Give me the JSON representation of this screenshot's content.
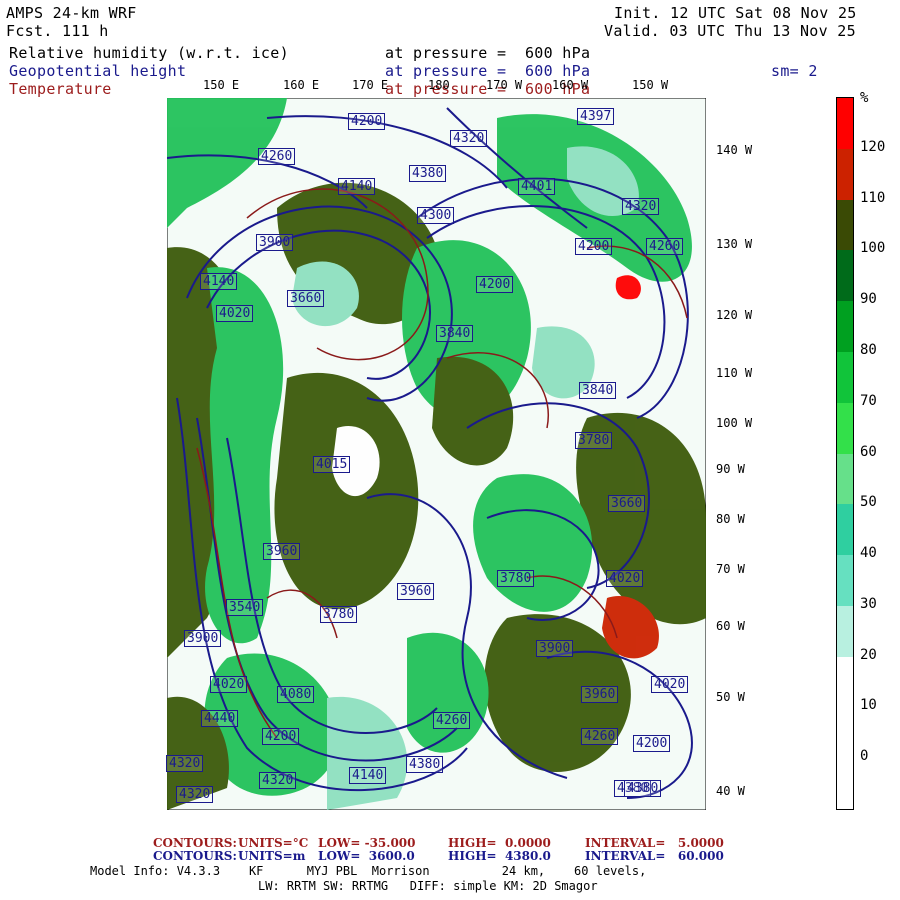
{
  "header": {
    "model": "AMPS 24-km WRF",
    "fcst": "Fcst. 111 h",
    "init": "Init. 12 UTC Sat 08 Nov 25",
    "valid": "Valid. 03 UTC Thu 13 Nov 25",
    "fields": [
      {
        "name": "Relative humidity (w.r.t. ice)",
        "level": "at pressure =  600 hPa"
      },
      {
        "name": "Geopotential height",
        "level": "at pressure =  600 hPa"
      },
      {
        "name": "Temperature",
        "level": "at pressure =  600 hPa"
      }
    ],
    "smoothing": "sm= 2"
  },
  "map": {
    "top_lon_labels": [
      "150 E",
      "160 E",
      "170 E",
      "180",
      "170 W",
      "160 W",
      "150 W"
    ],
    "right_lon_labels": [
      "140 W",
      "130 W",
      "120 W",
      "110 W",
      "100 W",
      "90 W",
      "80 W",
      "70 W",
      "60 W",
      "50 W",
      "40 W"
    ],
    "height_labels": [
      "4260",
      "4200",
      "4320",
      "4397",
      "4140",
      "4380",
      "4401",
      "4320",
      "3900",
      "4200",
      "4140",
      "4020",
      "3660",
      "4200",
      "4260",
      "4300",
      "3840",
      "3840",
      "3780",
      "4015",
      "3960",
      "3660",
      "3780",
      "4020",
      "3540",
      "3900",
      "3780",
      "3960",
      "4020",
      "3900",
      "4080",
      "4020",
      "3960",
      "4260",
      "4200",
      "4440",
      "4200",
      "4320",
      "4380",
      "4320",
      "4140",
      "4260",
      "4320",
      "4380",
      "4380"
    ],
    "colors": {
      "rh_dark": "#3c5a0a",
      "rh_green": "#22c25a",
      "rh_light": "#8ee0c0",
      "height_contour": "#1a1a8c",
      "temp_contour": "#8a1a1a"
    }
  },
  "colorbar": {
    "unit": "%",
    "labels": [
      "120",
      "110",
      "100",
      "90",
      "80",
      "70",
      "60",
      "50",
      "40",
      "30",
      "20",
      "10",
      "0"
    ],
    "segments": [
      "#ff0000",
      "#cc2200",
      "#3a4a05",
      "#006b1a",
      "#00a020",
      "#11c43a",
      "#33e04a",
      "#66e08a",
      "#2fcfa0",
      "#66e0c0",
      "#b8f0e0",
      "#ffffff",
      "#ffffff",
      "#ffffff"
    ]
  },
  "footer": {
    "temp_contours": {
      "label": "CONTOURS:",
      "units": "UNITS=°C",
      "low": "LOW= -35.000",
      "high": "HIGH=  0.0000",
      "interval": "INTERVAL=   5.0000"
    },
    "height_contours": {
      "label": "CONTOURS:",
      "units": "UNITS=m",
      "low": "LOW=  3600.0",
      "high": "HIGH=  4380.0",
      "interval": "INTERVAL=   60.000"
    },
    "model_info_1": "Model Info: V4.3.3    KF      MYJ PBL  Morrison          24 km,    60 levels,",
    "model_info_2": "LW: RRTM SW: RRTMG   DIFF: simple KM: 2D Smagor"
  }
}
